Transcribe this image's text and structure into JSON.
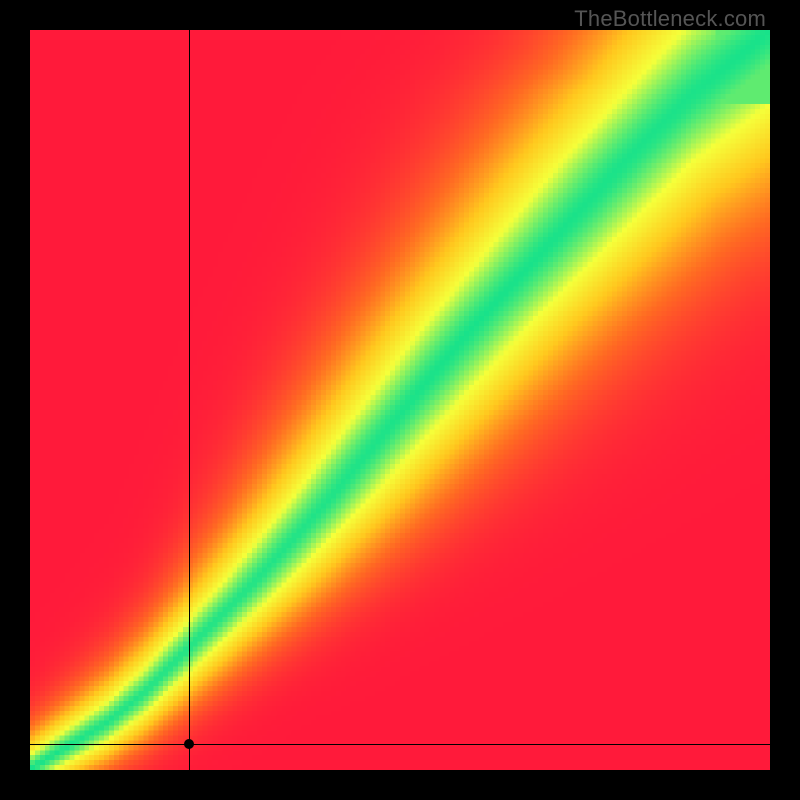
{
  "watermark": "TheBottleneck.com",
  "chart_data": {
    "type": "heatmap",
    "title": "",
    "xlabel": "",
    "ylabel": "",
    "xlim": [
      0,
      1
    ],
    "ylim": [
      0,
      1
    ],
    "colorscale": [
      {
        "stop": 0.0,
        "hex": "#ff1a3a"
      },
      {
        "stop": 0.25,
        "hex": "#ff6a22"
      },
      {
        "stop": 0.5,
        "hex": "#ffc81e"
      },
      {
        "stop": 0.75,
        "hex": "#f5ff3a"
      },
      {
        "stop": 1.0,
        "hex": "#18e28a"
      }
    ],
    "ideal_curve": {
      "description": "Locus of maximum compatibility (green ridge)",
      "points": [
        {
          "x": 0.0,
          "y": 0.0
        },
        {
          "x": 0.05,
          "y": 0.03
        },
        {
          "x": 0.1,
          "y": 0.06
        },
        {
          "x": 0.15,
          "y": 0.1
        },
        {
          "x": 0.2,
          "y": 0.15
        },
        {
          "x": 0.3,
          "y": 0.25
        },
        {
          "x": 0.4,
          "y": 0.36
        },
        {
          "x": 0.5,
          "y": 0.48
        },
        {
          "x": 0.6,
          "y": 0.6
        },
        {
          "x": 0.7,
          "y": 0.71
        },
        {
          "x": 0.8,
          "y": 0.82
        },
        {
          "x": 0.9,
          "y": 0.92
        },
        {
          "x": 1.0,
          "y": 1.0
        }
      ]
    },
    "band_halfwidth": {
      "description": "Approx half-width of green band as fraction of full scale",
      "at_center": 0.04,
      "at_upper_right": 0.1
    },
    "marker": {
      "x": 0.215,
      "y": 0.035
    },
    "crosshair": {
      "x": 0.215,
      "y": 0.035
    }
  },
  "colors": {
    "frame": "#000000",
    "watermark": "#555555",
    "marker": "#000000",
    "crosshair": "#000000"
  }
}
